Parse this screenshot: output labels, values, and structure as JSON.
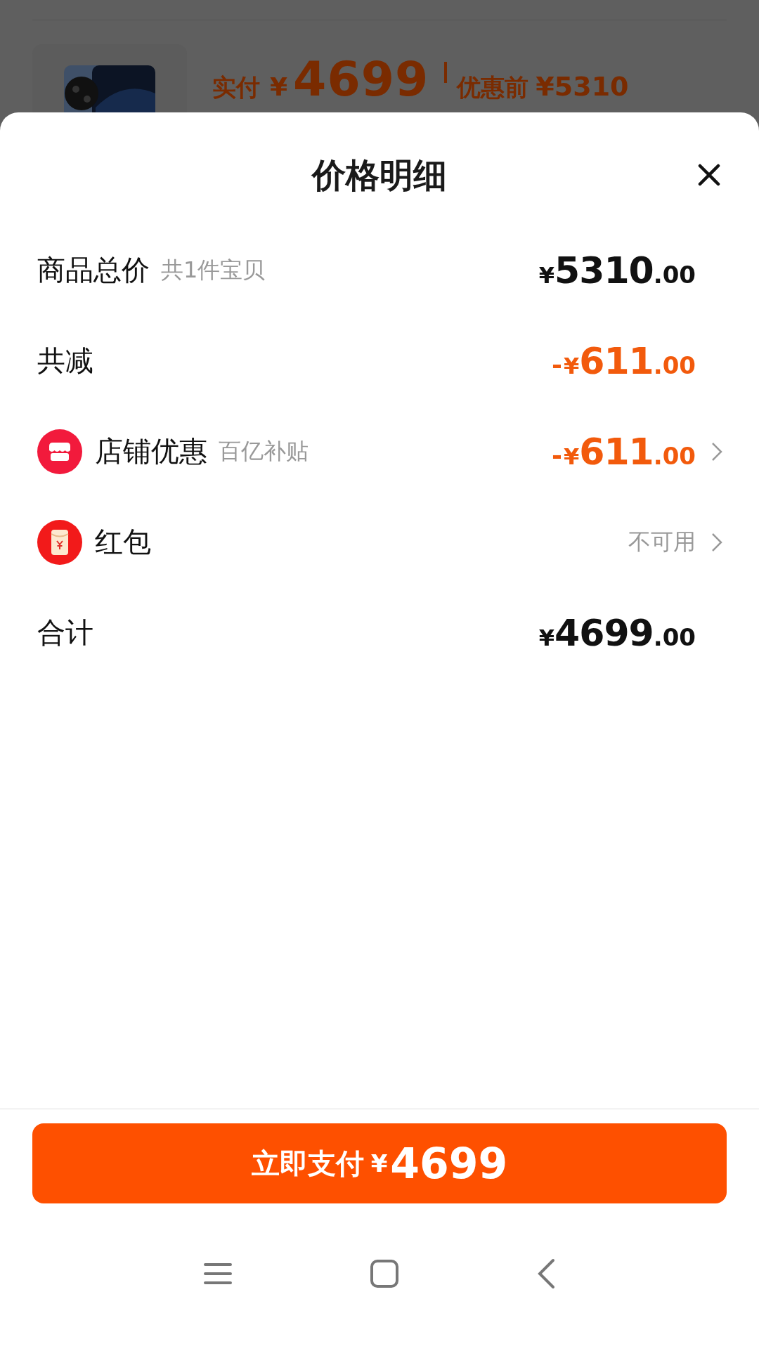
{
  "background": {
    "price_label": "实付",
    "price_currency": "¥",
    "price": "4699",
    "original_label": "优惠前",
    "original_price": "¥5310"
  },
  "sheet": {
    "title": "价格明细"
  },
  "rows": [
    {
      "kind": "plain",
      "label": "商品总价",
      "note": "共1件宝贝",
      "discount": false,
      "sign": "",
      "currency": "¥",
      "integer": "5310",
      "decimal": ".00",
      "has_arrow": false
    },
    {
      "kind": "plain",
      "label": "共减",
      "discount": true,
      "sign": "-",
      "currency": "¥",
      "integer": "611",
      "decimal": ".00",
      "has_arrow": false
    },
    {
      "kind": "store",
      "label": "店铺优惠",
      "note": "百亿补贴",
      "discount": true,
      "sign": "-",
      "currency": "¥",
      "integer": "611",
      "decimal": ".00",
      "has_arrow": true
    },
    {
      "kind": "packet",
      "label": "红包",
      "text": "不可用",
      "has_arrow": true
    },
    {
      "kind": "plain",
      "label": "合计",
      "discount": false,
      "sign": "",
      "currency": "¥",
      "integer": "4699",
      "decimal": ".00",
      "has_arrow": false
    }
  ],
  "pay_button": {
    "label": "立即支付",
    "currency": "¥",
    "amount": "4699"
  }
}
